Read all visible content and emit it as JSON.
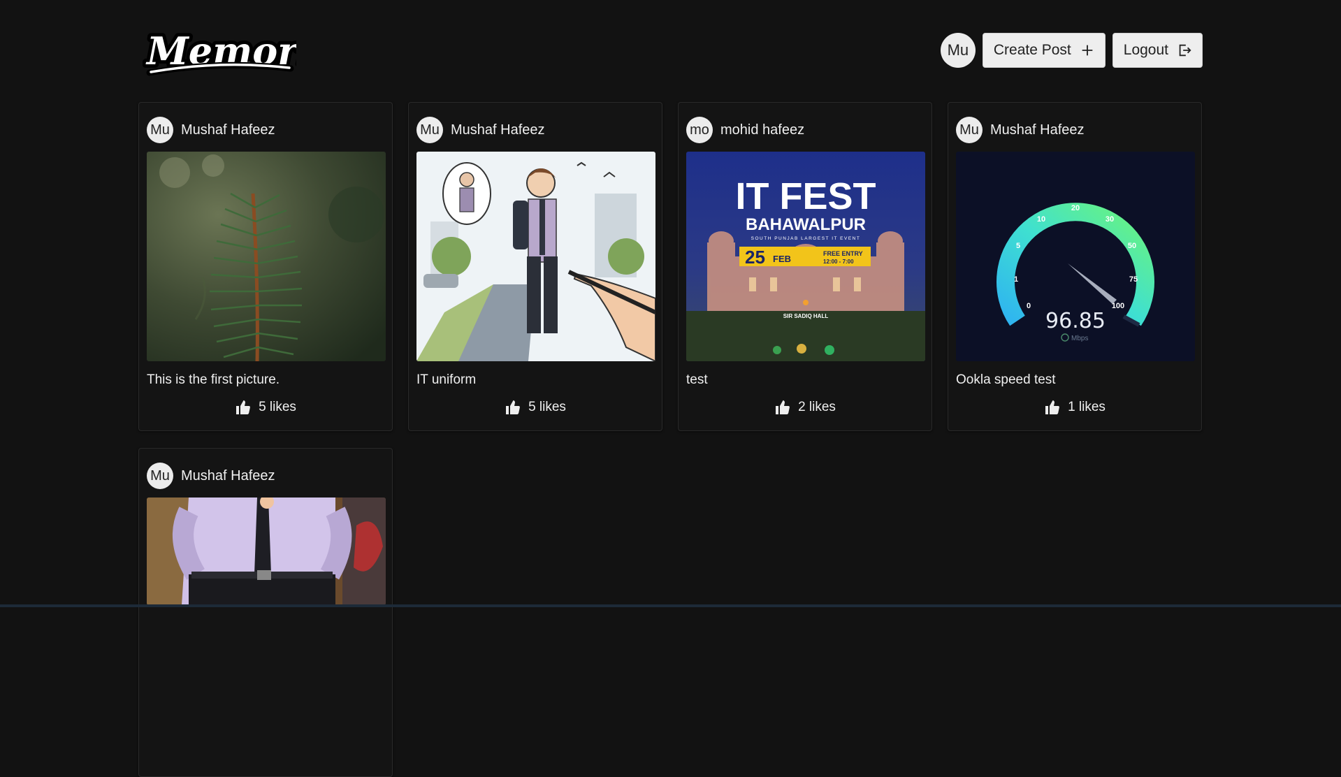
{
  "header": {
    "logo_text": "Memories",
    "user_initials": "Mu",
    "create_post_label": "Create Post",
    "logout_label": "Logout"
  },
  "posts": [
    {
      "initials": "Mu",
      "author": "Mushaf Hafeez",
      "caption": "This is the first picture.",
      "likes": "5 likes",
      "image": "pine-branch"
    },
    {
      "initials": "Mu",
      "author": "Mushaf Hafeez",
      "caption": "IT uniform",
      "likes": "5 likes",
      "image": "illustrated-student"
    },
    {
      "initials": "mo",
      "author": "mohid hafeez",
      "caption": "test",
      "likes": "2 likes",
      "image": "it-fest-poster",
      "poster": {
        "title": "IT FEST",
        "city": "BAHAWALPUR",
        "tagline": "SOUTH PUNJAB LARGEST IT EVENT",
        "date": "25",
        "month": "FEB",
        "entry": "FREE ENTRY",
        "time": "12:00 - 7:00",
        "venue": "SIR SADIQ HALL"
      }
    },
    {
      "initials": "Mu",
      "author": "Mushaf Hafeez",
      "caption": "Ookla speed test",
      "likes": "1 likes",
      "image": "speed-gauge",
      "gauge": {
        "value": "96.85",
        "unit": "Mbps",
        "ticks": [
          "0",
          "1",
          "5",
          "10",
          "20",
          "30",
          "50",
          "75",
          "100"
        ]
      }
    },
    {
      "initials": "Mu",
      "author": "Mushaf Hafeez",
      "caption": "",
      "likes": "",
      "image": "uniform-photo"
    }
  ],
  "colors": {
    "background": "#121212",
    "card": "#141414",
    "button": "#eeeeee"
  }
}
